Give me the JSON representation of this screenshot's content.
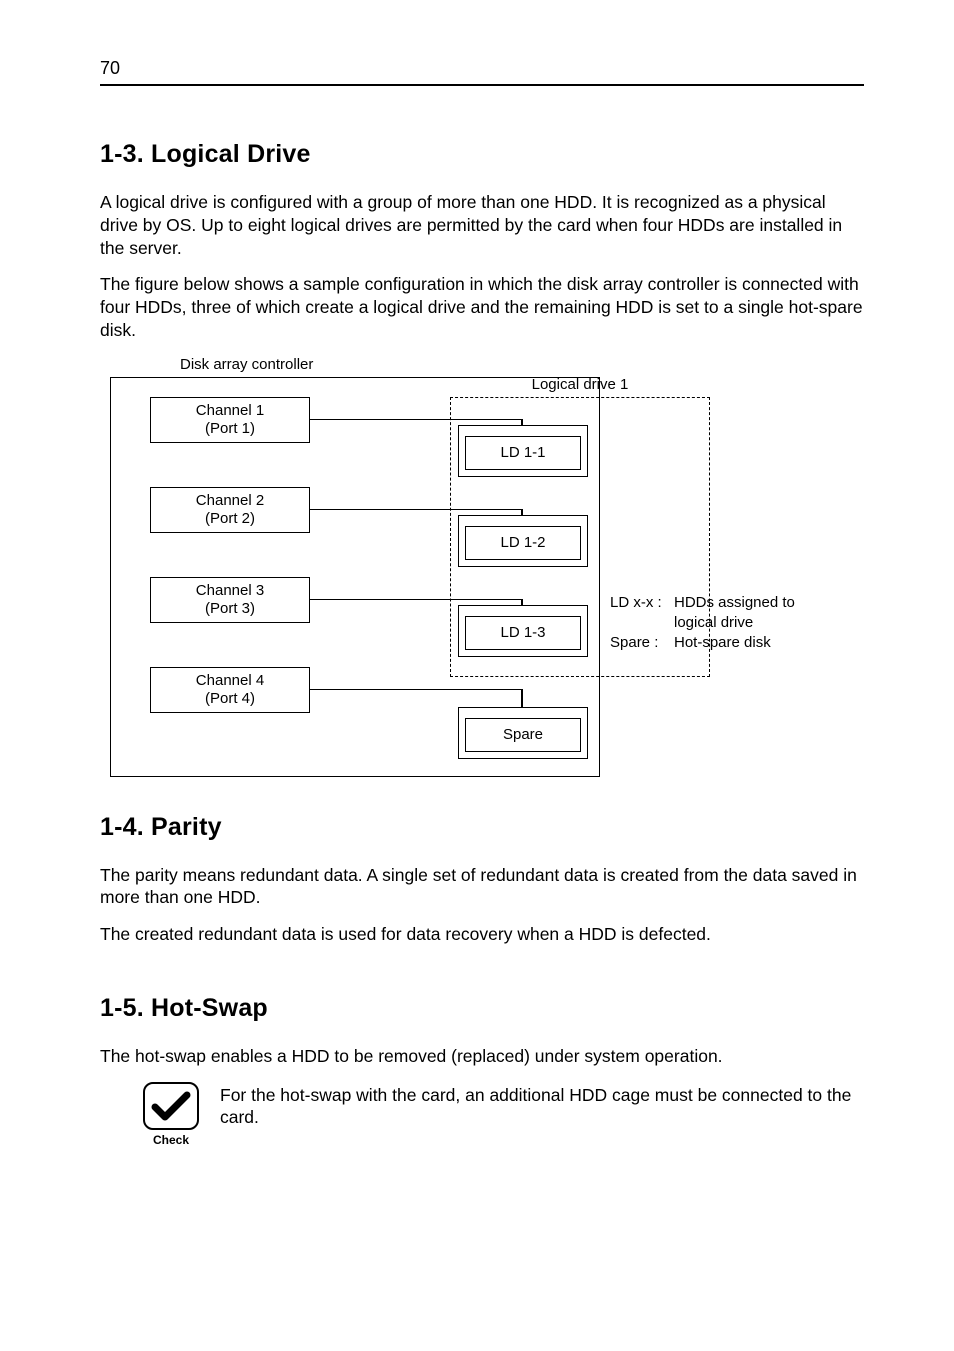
{
  "page_number": "70",
  "sections": {
    "logical_drive": {
      "heading": "1-3. Logical Drive",
      "para1": "A logical drive is configured with a group of more than one HDD. It is recognized as a physical drive by OS. Up to eight logical drives are permitted by the card when four HDDs are installed in the server.",
      "para2": "The figure below shows a sample configuration in which the disk array controller is connected with four HDDs, three of which create a logical drive and the remaining HDD is set to a single hot-spare disk."
    },
    "parity": {
      "heading": "1-4. Parity",
      "para1": "The parity means redundant data. A single set of redundant data is created from the data saved in more than one HDD.",
      "para2": "The created redundant data is used for data recovery when a HDD is defected."
    },
    "hot_swap": {
      "heading": "1-5. Hot-Swap",
      "para1": "The hot-swap enables a HDD to be removed (replaced) under system operation.",
      "check_label": "Check",
      "check_text": "For the hot-swap with the card, an additional HDD cage must be connected to the card."
    }
  },
  "diagram": {
    "caption": "Disk array controller",
    "group_label": "Logical drive 1",
    "channels": {
      "ch1_l1": "Channel 1",
      "ch1_l2": "(Port 1)",
      "ch2_l1": "Channel 2",
      "ch2_l2": "(Port 2)",
      "ch3_l1": "Channel 3",
      "ch3_l2": "(Port 3)",
      "ch4_l1": "Channel 4",
      "ch4_l2": "(Port 4)"
    },
    "hdds": {
      "ld1": "LD 1-1",
      "ld2": "LD 1-2",
      "ld3": "LD 1-3",
      "spare": "Spare"
    },
    "legend": {
      "k1": "LD x-x :",
      "v1a": "HDDs assigned to",
      "v1b": "logical drive",
      "k2": "Spare :",
      "v2": "Hot-spare disk"
    }
  }
}
